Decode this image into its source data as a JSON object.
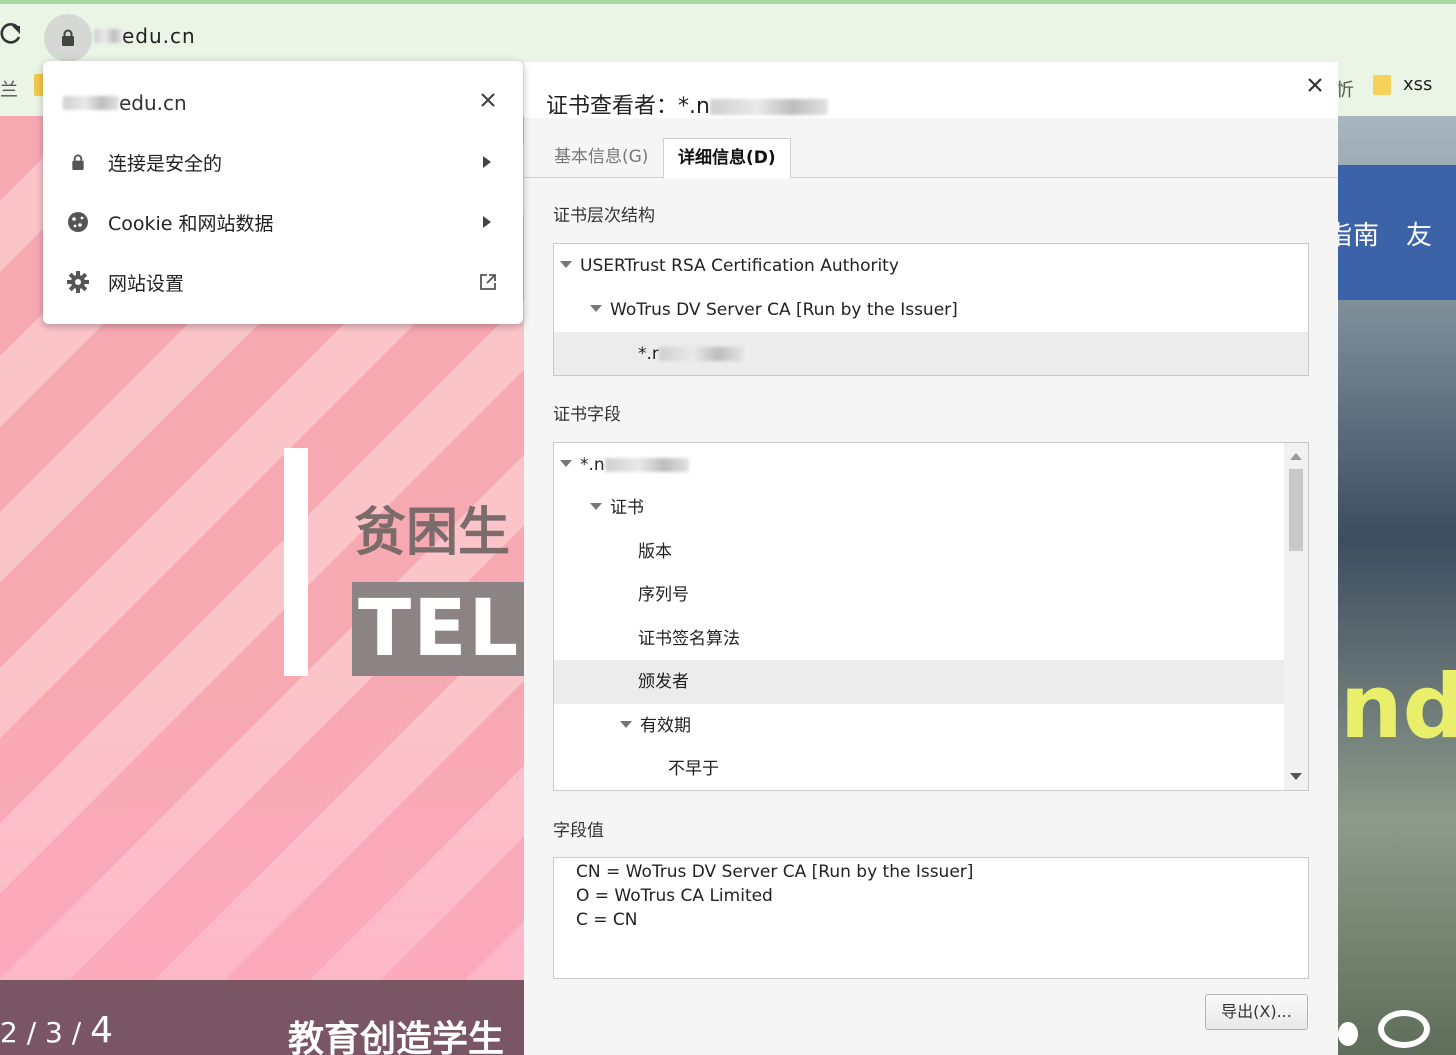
{
  "browser": {
    "url_visible": "edu.cn",
    "bookmarks": {
      "left_partial": "兰",
      "right_partial": "忻",
      "folder_xss": "xss"
    }
  },
  "site_popup": {
    "domain_visible": "edu.cn",
    "rows": [
      {
        "label": "连接是安全的",
        "icon": "lock-icon",
        "trailing": "arrow"
      },
      {
        "label": "Cookie 和网站数据",
        "icon": "cookie-icon",
        "trailing": "arrow"
      },
      {
        "label": "网站设置",
        "icon": "gear-icon",
        "trailing": "external-link"
      }
    ]
  },
  "cert_viewer": {
    "title_prefix": "证书查看者：*.n",
    "tabs": [
      {
        "label": "基本信息(G)",
        "active": false
      },
      {
        "label": "详细信息(D)",
        "active": true
      }
    ],
    "hierarchy_label": "证书层次结构",
    "hierarchy": [
      {
        "label": "USERTrust RSA Certification Authority",
        "level": 0,
        "expanded": true
      },
      {
        "label": "WoTrus DV Server CA  [Run by the Issuer]",
        "level": 1,
        "expanded": true
      },
      {
        "label": "*.r",
        "level": 2,
        "selected": true
      }
    ],
    "fields_label": "证书字段",
    "fields": [
      {
        "label": "*.n",
        "level": 0,
        "expanded": true
      },
      {
        "label": "证书",
        "level": 1,
        "expanded": true
      },
      {
        "label": "版本",
        "level": 2
      },
      {
        "label": "序列号",
        "level": 2
      },
      {
        "label": "证书签名算法",
        "level": 2
      },
      {
        "label": "颁发者",
        "level": 2,
        "selected": true
      },
      {
        "label": "有效期",
        "level": 2,
        "expanded": true
      },
      {
        "label": "不早于",
        "level": 3
      }
    ],
    "value_label": "字段值",
    "value_lines": [
      "CN = WoTrus DV Server CA  [Run by the Issuer]",
      "O = WoTrus CA Limited",
      "C = CN"
    ],
    "export_label": "导出(X)..."
  },
  "background_page": {
    "hero_title": "贫困生",
    "hero_box_text": "TEL",
    "pager_prefix": "2 / 3 / ",
    "pager_current": "4",
    "slogan": "教育创造学生",
    "nav_items": [
      "指南",
      "友"
    ],
    "yellow_text": "ndi"
  }
}
